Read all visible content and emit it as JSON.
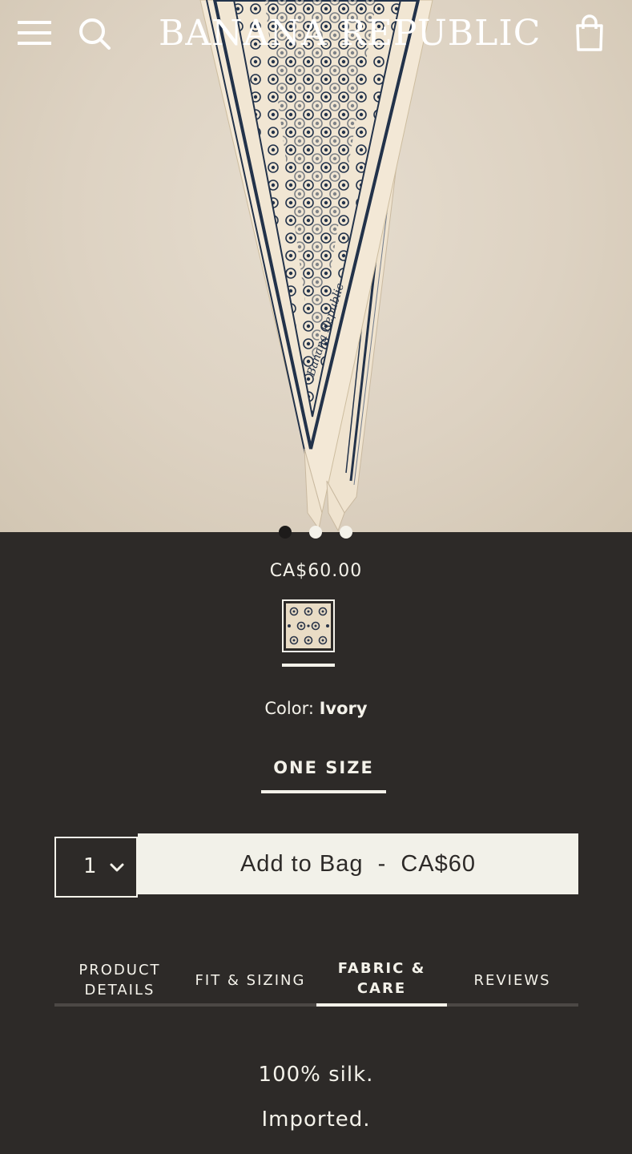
{
  "header": {
    "logo": "BANANA REPUBLIC",
    "menu_icon": "hamburger-menu-icon",
    "search_icon": "search-icon",
    "bag_icon": "shopping-bag-icon"
  },
  "hero": {
    "image_subject": "ivory silk scarf with navy medallion print",
    "image_text": "Banana Republic",
    "carousel": {
      "total": 3,
      "active": 1
    }
  },
  "product": {
    "price": "CA$60.00",
    "color_label": "Color: ",
    "color_value": "Ivory",
    "size": "ONE SIZE",
    "quantity": "1",
    "add_to_bag": "Add to Bag  -  CA$60"
  },
  "tabs": [
    {
      "label": "PRODUCT\nDETAILS",
      "active": false
    },
    {
      "label": "FIT & SIZING",
      "active": false
    },
    {
      "label": "FABRIC &\nCARE",
      "active": true
    },
    {
      "label": "REVIEWS",
      "active": false
    }
  ],
  "tab_content": [
    "100% silk.",
    "Imported."
  ],
  "colors": {
    "background": "#2d2a28",
    "button": "#f2f1e9",
    "text": "#f4f2ea"
  }
}
